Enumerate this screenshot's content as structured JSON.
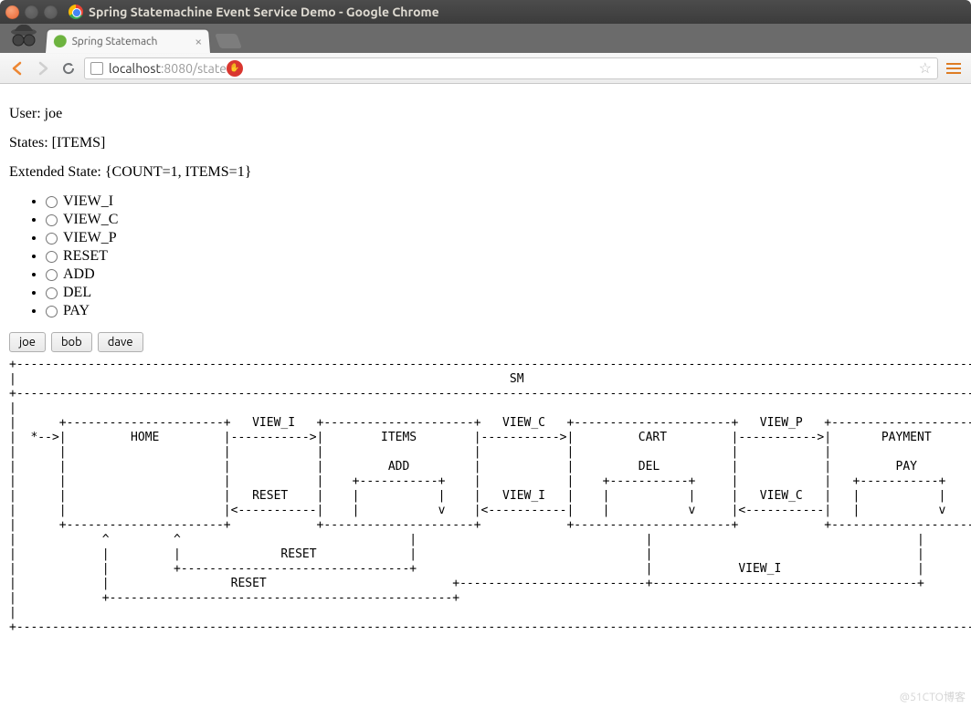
{
  "window": {
    "title": "Spring Statemachine Event Service Demo - Google Chrome"
  },
  "tab": {
    "title": "Spring Statemach"
  },
  "url": {
    "host": "localhost",
    "port_path": ":8080/state"
  },
  "content": {
    "user_label": "User: ",
    "user_value": "joe",
    "states_label": "States: ",
    "states_value": "[ITEMS]",
    "ext_label": "Extended State: ",
    "ext_value": "{COUNT=1, ITEMS=1}"
  },
  "events": [
    "VIEW_I",
    "VIEW_C",
    "VIEW_P",
    "RESET",
    "ADD",
    "DEL",
    "PAY"
  ],
  "buttons": [
    "joe",
    "bob",
    "dave"
  ],
  "diagram": "+----------------------------------------------------------------------------------------------------------------------------------------------+\n|                                                                     SM                                                                       |\n+----------------------------------------------------------------------------------------------------------------------------------------------+\n|                                                                                                                                              |\n|      +----------------------+   VIEW_I   +---------------------+   VIEW_C   +----------------------+   VIEW_P   +---------------------+     |\n|  *-->|         HOME         |----------->|        ITEMS        |----------->|         CART         |----------->|       PAYMENT       |     |\n|      |                      |            |                     |            |                      |            |                     |     |\n|      |                      |            |         ADD         |            |         DEL          |            |         PAY         |     |\n|      |                      |            |    +-----------+    |            |    +-----------+     |            |   +-----------+     |     |\n|      |                      |   RESET    |    |           |    |   VIEW_I   |    |           |     |   VIEW_C   |   |           |     |     |\n|      |                      |<-----------|    |           v    |<-----------|    |           v     |<-----------|   |           v     |     |\n|      +----------------------+            +---------------------+            +----------------------+            +---------------------+     |\n|            ^         ^                                |                                |                                     |              |\n|            |         |              RESET             |                                |                                     |              |\n|            |         +--------------------------------+                                |            VIEW_I                   |              |\n|            |                 RESET                          +--------------------------+-------------------------------------+              |\n|            +------------------------------------------------+                                                                               |\n|                                                                                                                                              |\n+----------------------------------------------------------------------------------------------------------------------------------------------+",
  "watermark": "@51CTO博客"
}
